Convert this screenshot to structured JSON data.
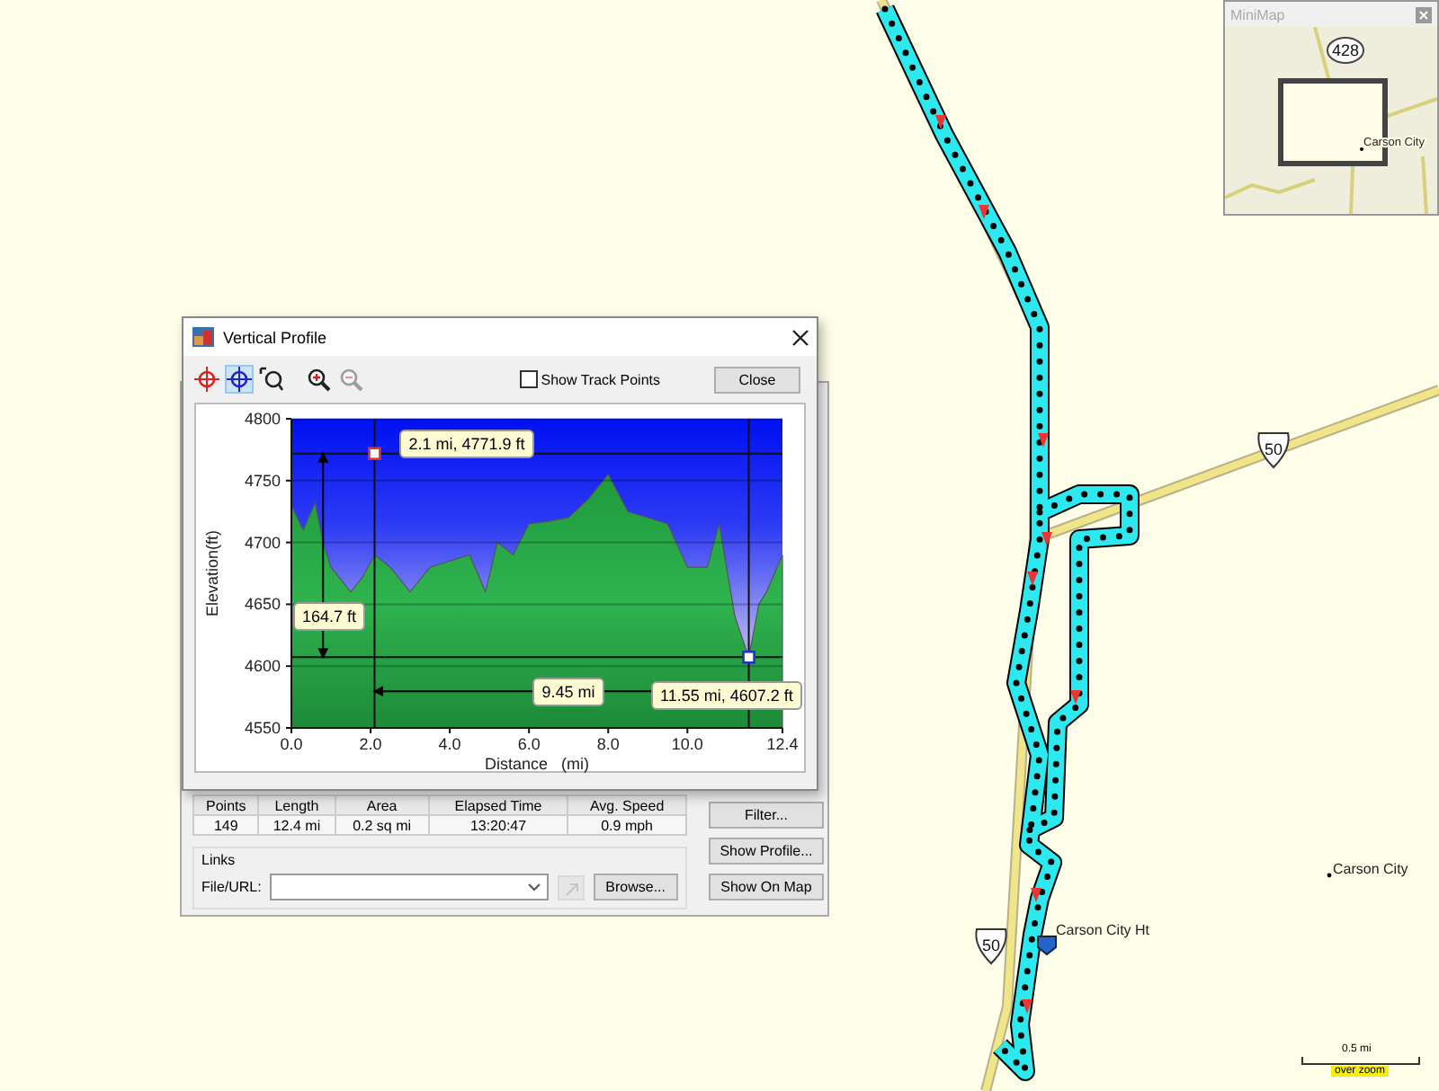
{
  "map": {
    "shields": [
      "50",
      "50"
    ],
    "labels": [
      {
        "text": "Carson City Ht",
        "kind": "waypoint"
      },
      {
        "text": "Carson City",
        "kind": "city"
      }
    ],
    "scale": {
      "distance": "0.5 mi",
      "note": "over zoom"
    }
  },
  "minimap": {
    "title": "MiniMap",
    "shield": "428",
    "label": "Carson City"
  },
  "track_dialog": {
    "stats": {
      "columns": [
        "Points",
        "Length",
        "Area",
        "Elapsed Time",
        "Avg. Speed"
      ],
      "values": [
        "149",
        "12.4 mi",
        "0.2 sq mi",
        "13:20:47",
        "0.9 mph"
      ]
    },
    "links": {
      "title": "Links",
      "field_label": "File/URL:",
      "open_disabled": true,
      "browse": "Browse..."
    },
    "buttons": [
      "Filter...",
      "Show Profile...",
      "Show On Map"
    ]
  },
  "profile_window": {
    "title": "Vertical Profile",
    "tools": [
      {
        "kind": "marker",
        "selected": false,
        "disabled": false
      },
      {
        "kind": "measure",
        "selected": true,
        "disabled": false
      },
      {
        "kind": "zoombox",
        "selected": false,
        "disabled": false
      },
      {
        "kind": "zoomin",
        "selected": false,
        "disabled": false
      },
      {
        "kind": "zoomout",
        "selected": false,
        "disabled": true
      }
    ],
    "show_track_points": {
      "label": "Show Track Points",
      "checked": false
    },
    "close": "Close",
    "chart_data": {
      "type": "area",
      "xlabel": "Distance   (mi)",
      "ylabel": "Elevation(ft)",
      "grid": true,
      "x": [
        0,
        0.3,
        0.6,
        0.8,
        1.0,
        1.5,
        1.8,
        2.1,
        2.5,
        3.0,
        3.5,
        4.0,
        4.5,
        4.9,
        5.2,
        5.6,
        6.0,
        6.5,
        7.0,
        7.5,
        8.0,
        8.5,
        9.0,
        9.5,
        10.0,
        10.5,
        10.8,
        11.2,
        11.55,
        11.8,
        12.0,
        12.4
      ],
      "values": [
        4730,
        4710,
        4732,
        4700,
        4680,
        4660,
        4672,
        4690,
        4680,
        4660,
        4680,
        4685,
        4690,
        4660,
        4700,
        4690,
        4715,
        4717,
        4720,
        4735,
        4755,
        4725,
        4720,
        4715,
        4680,
        4680,
        4715,
        4640,
        4607,
        4650,
        4660,
        4690
      ],
      "xlim": [
        0,
        12.4
      ],
      "ylim": [
        4550,
        4800
      ],
      "xticks": [
        {
          "value": 0,
          "label": "0.0"
        },
        {
          "value": 2,
          "label": "2.0"
        },
        {
          "value": 4,
          "label": "4.0"
        },
        {
          "value": 6,
          "label": "6.0"
        },
        {
          "value": 8,
          "label": "8.0"
        },
        {
          "value": 10,
          "label": "10.0"
        },
        {
          "value": 12.4,
          "label": "12.4"
        }
      ],
      "yticks": [
        4550,
        4600,
        4650,
        4700,
        4750,
        4800
      ],
      "annotations": [
        {
          "x": 2.1,
          "y": 4771.9,
          "text": "2.1 mi, 4771.9 ft"
        },
        "164.7 ft",
        "9.45 mi",
        {
          "x": 11.55,
          "y": 4607.2,
          "text": "11.55 mi, 4607.2 ft"
        }
      ]
    }
  }
}
